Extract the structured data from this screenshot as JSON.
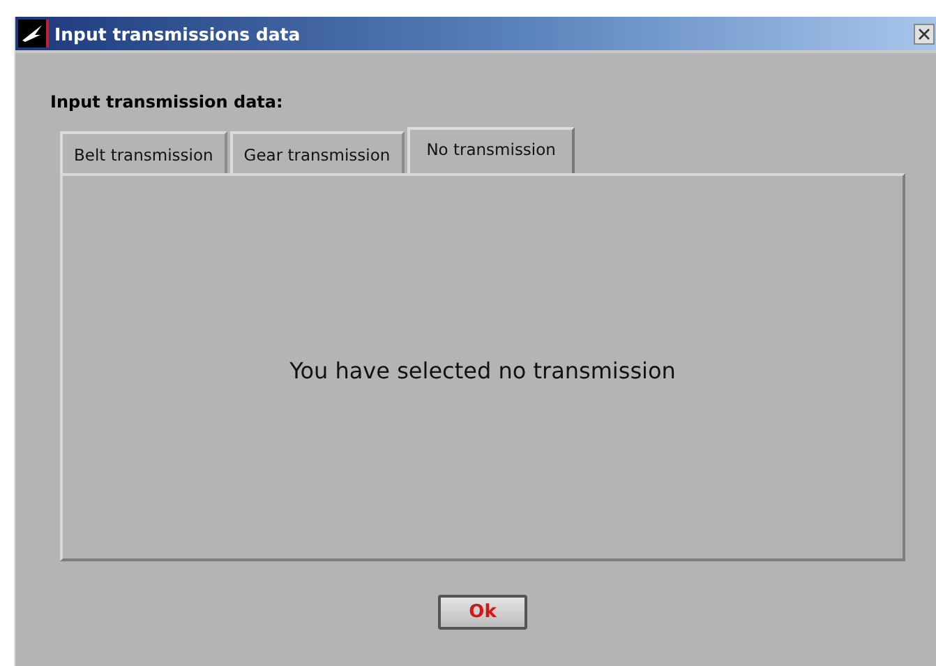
{
  "window": {
    "title": "Input transmissions data"
  },
  "heading": "Input transmission data:",
  "tabs": [
    {
      "label": "Belt transmission",
      "selected": false
    },
    {
      "label": "Gear transmission",
      "selected": false
    },
    {
      "label": "No transmission",
      "selected": true
    }
  ],
  "message": "You have selected no transmission",
  "buttons": [
    {
      "label": "Ok"
    }
  ]
}
